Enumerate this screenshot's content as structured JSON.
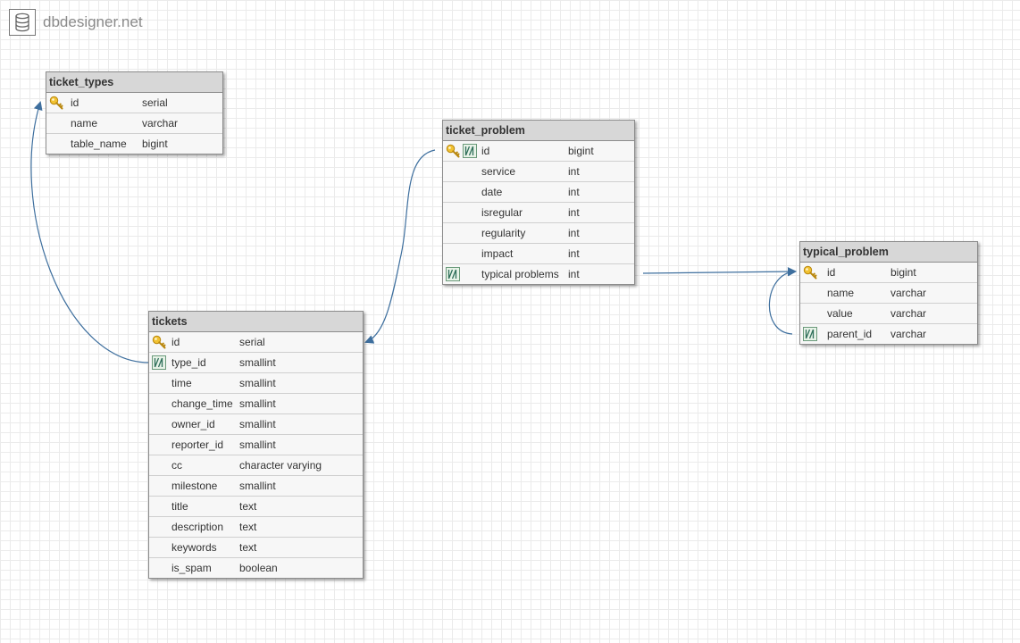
{
  "brand": {
    "name": "dbdesigner.net",
    "icon": "database-icon"
  },
  "colors": {
    "connector": "#3e6f9e",
    "header_bg": "#d7d7d7",
    "grid": "#ebebeb"
  },
  "tables": {
    "ticket_types": {
      "name": "ticket_types",
      "fields": [
        {
          "name": "id",
          "type": "serial",
          "pk": true,
          "fk": false
        },
        {
          "name": "name",
          "type": "varchar",
          "pk": false,
          "fk": false
        },
        {
          "name": "table_name",
          "type": "bigint",
          "pk": false,
          "fk": false
        }
      ]
    },
    "ticket_problem": {
      "name": "ticket_problem",
      "fields": [
        {
          "name": "id",
          "type": "bigint",
          "pk": true,
          "fk": true
        },
        {
          "name": "service",
          "type": "int",
          "pk": false,
          "fk": false
        },
        {
          "name": "date",
          "type": "int",
          "pk": false,
          "fk": false
        },
        {
          "name": "isregular",
          "type": "int",
          "pk": false,
          "fk": false
        },
        {
          "name": "regularity",
          "type": "int",
          "pk": false,
          "fk": false
        },
        {
          "name": "impact",
          "type": "int",
          "pk": false,
          "fk": false
        },
        {
          "name": "typical problems",
          "type": "int",
          "pk": false,
          "fk": true
        }
      ]
    },
    "typical_problem": {
      "name": "typical_problem",
      "fields": [
        {
          "name": "id",
          "type": "bigint",
          "pk": true,
          "fk": false
        },
        {
          "name": "name",
          "type": "varchar",
          "pk": false,
          "fk": false
        },
        {
          "name": "value",
          "type": "varchar",
          "pk": false,
          "fk": false
        },
        {
          "name": "parent_id",
          "type": "varchar",
          "pk": false,
          "fk": true
        }
      ]
    },
    "tickets": {
      "name": "tickets",
      "fields": [
        {
          "name": "id",
          "type": "serial",
          "pk": true,
          "fk": false
        },
        {
          "name": "type_id",
          "type": "smallint",
          "pk": false,
          "fk": true
        },
        {
          "name": "time",
          "type": "smallint",
          "pk": false,
          "fk": false
        },
        {
          "name": "change_time",
          "type": "smallint",
          "pk": false,
          "fk": false
        },
        {
          "name": "owner_id",
          "type": "smallint",
          "pk": false,
          "fk": false
        },
        {
          "name": "reporter_id",
          "type": "smallint",
          "pk": false,
          "fk": false
        },
        {
          "name": "cc",
          "type": "character varying",
          "pk": false,
          "fk": false
        },
        {
          "name": "milestone",
          "type": "smallint",
          "pk": false,
          "fk": false
        },
        {
          "name": "title",
          "type": "text",
          "pk": false,
          "fk": false
        },
        {
          "name": "description",
          "type": "text",
          "pk": false,
          "fk": false
        },
        {
          "name": "keywords",
          "type": "text",
          "pk": false,
          "fk": false
        },
        {
          "name": "is_spam",
          "type": "boolean",
          "pk": false,
          "fk": false
        }
      ]
    }
  },
  "relations": [
    {
      "from": "tickets.type_id",
      "to": "ticket_types.id"
    },
    {
      "from": "ticket_problem.id",
      "to": "tickets.id"
    },
    {
      "from": "ticket_problem.typical problems",
      "to": "typical_problem.id"
    },
    {
      "from": "typical_problem.parent_id",
      "to": "typical_problem.id"
    }
  ]
}
